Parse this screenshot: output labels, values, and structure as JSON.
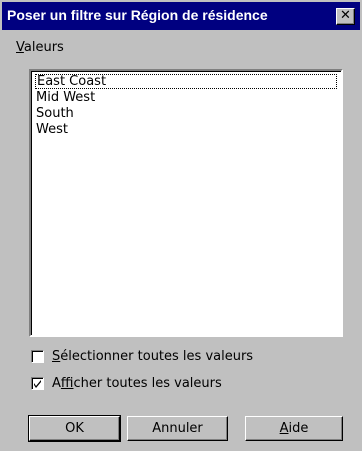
{
  "window": {
    "title": "Poser un filtre sur Région de résidence",
    "close_glyph": "✕"
  },
  "values_label": {
    "mnemonic": "V",
    "rest": "aleurs"
  },
  "list": {
    "items": [
      "East Coast",
      "Mid West",
      "South",
      "West"
    ],
    "focused_index": 0
  },
  "select_all": {
    "mnemonic": "S",
    "rest": "électionner toutes les valeurs",
    "checked": false
  },
  "show_all": {
    "prefix": "A",
    "mnemonic": "f",
    "rest": "ficher toutes les valeurs",
    "checked": true
  },
  "buttons": {
    "ok": "OK",
    "cancel": "Annuler",
    "help_mnemonic": "A",
    "help_rest": "ide"
  },
  "colors": {
    "titlebar": "#000080",
    "face": "#c0c0c0"
  }
}
